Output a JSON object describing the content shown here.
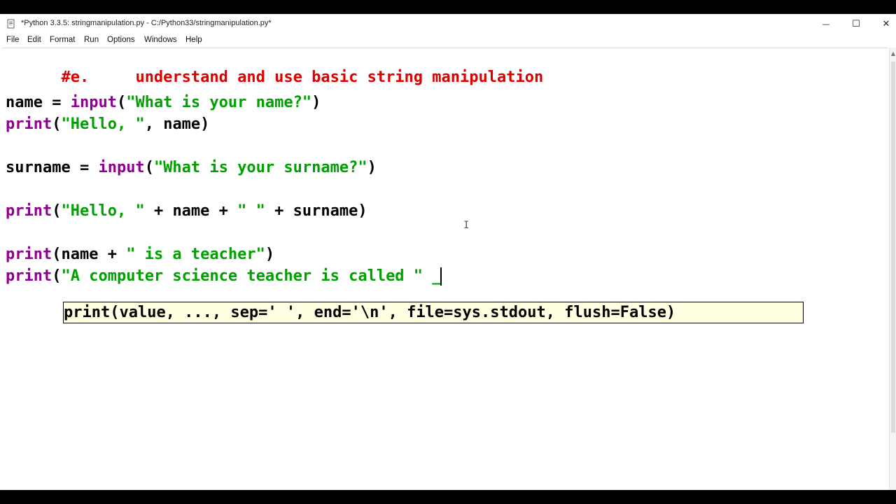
{
  "window": {
    "title": "*Python 3.3.5: stringmanipulation.py - C:/Python33/stringmanipulation.py*",
    "minimize_glyph": "—",
    "maximize_glyph": "☐",
    "close_glyph": "✕"
  },
  "menu": {
    "items": [
      "File",
      "Edit",
      "Format",
      "Run",
      "Options",
      "Windows",
      "Help"
    ]
  },
  "editor": {
    "line1": {
      "comment": "#e.     understand and use basic string manipulation"
    },
    "line2": {
      "v1": "name = ",
      "kw": "input",
      "p1": "(",
      "s1": "\"What is your name?\"",
      "p2": ")"
    },
    "line3": {
      "kw": "print",
      "p1": "(",
      "s1": "\"Hello, \"",
      "p2": ", name)"
    },
    "line4": {
      "v1": "surname = ",
      "kw": "input",
      "p1": "(",
      "s1": "\"What is your surname?\"",
      "p2": ")"
    },
    "line5": {
      "kw": "print",
      "p1": "(",
      "s1": "\"Hello, \"",
      "p2": " + name + ",
      "s2": "\" \"",
      "p3": " + surname)"
    },
    "line6": {
      "kw": "print",
      "p1": "(name + ",
      "s1": "\" is a teacher\"",
      "p2": ")"
    },
    "line7": {
      "kw": "print",
      "p1": "(",
      "s1": "\"A computer science teacher is called \" _"
    }
  },
  "calltip": {
    "text": "print(value, ..., sep=' ', end='\\n', file=sys.stdout, flush=False)"
  },
  "colors": {
    "keyword": "#900090",
    "string": "#00a000",
    "comment": "#dd0000",
    "calltip_bg": "#ffffe1"
  }
}
